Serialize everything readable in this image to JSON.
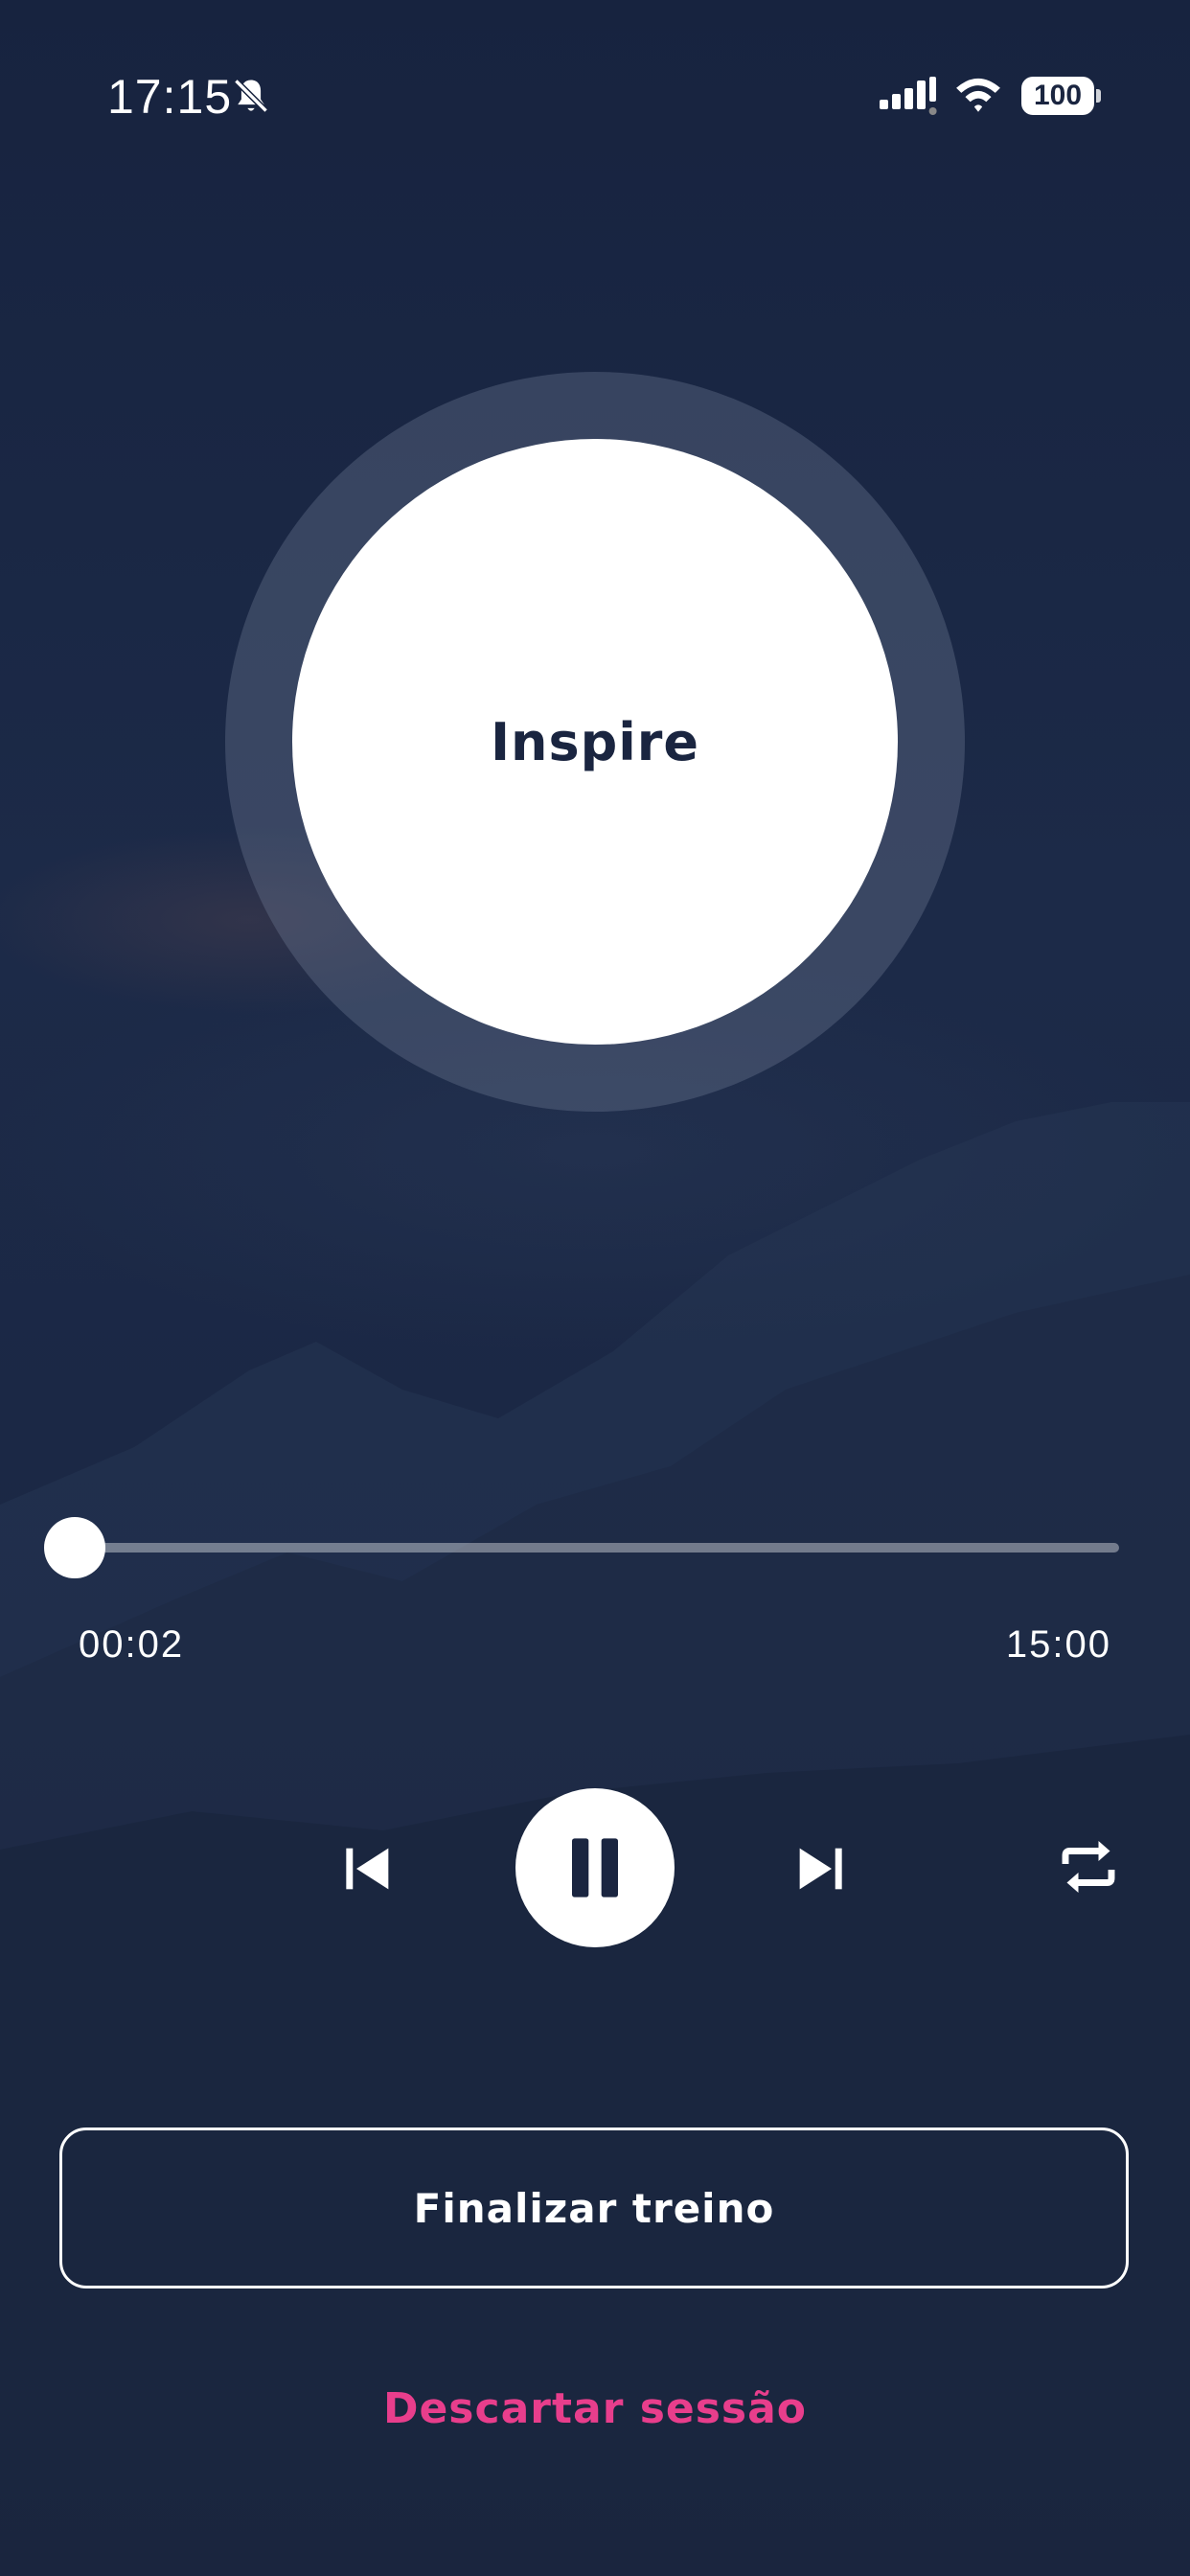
{
  "status_bar": {
    "time": "17:15",
    "icons": [
      "bell-off-icon",
      "signal-icon",
      "wifi-icon",
      "battery-icon"
    ],
    "battery_level": "100"
  },
  "breath": {
    "label": "Inspire"
  },
  "player": {
    "elapsed": "00:02",
    "total": "15:00",
    "progress_fraction": 0.0022,
    "controls": [
      "previous-icon",
      "pause-icon",
      "next-icon",
      "repeat-icon"
    ]
  },
  "actions": {
    "finish_label": "Finalizar treino",
    "discard_label": "Descartar sessão"
  },
  "colors": {
    "background": "#1a2540",
    "accent_pink": "#e83e8c",
    "text": "#ffffff",
    "circle_text": "#1a2540"
  }
}
